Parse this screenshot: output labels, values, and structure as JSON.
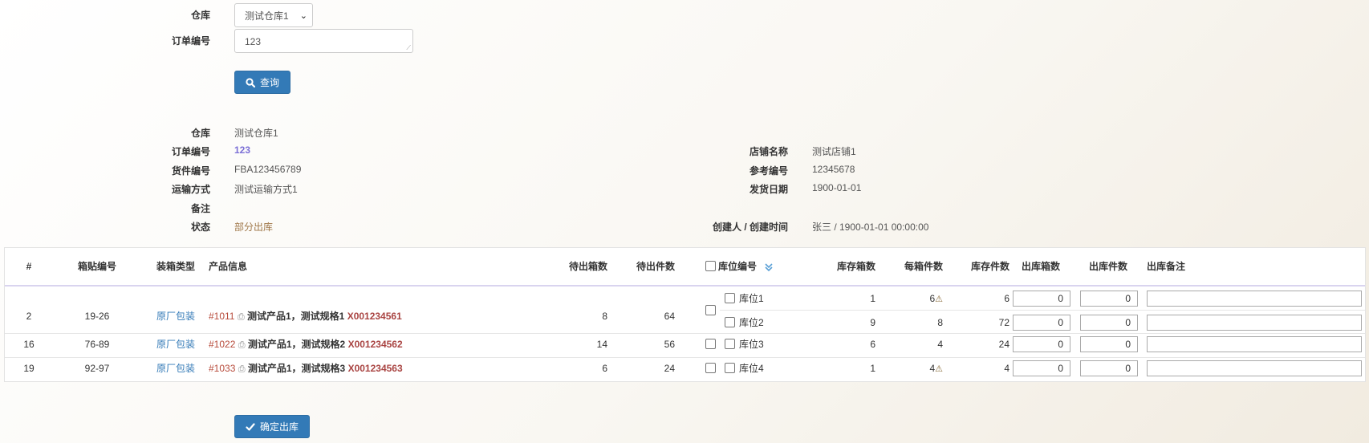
{
  "search_form": {
    "warehouse_label": "仓库",
    "warehouse_value": "测试仓库1",
    "order_label": "订单编号",
    "order_value": "123",
    "query_button": "查询"
  },
  "details": {
    "warehouse_label": "仓库",
    "warehouse_value": "测试仓库1",
    "order_label": "订单编号",
    "order_value": "123",
    "cargo_label": "货件编号",
    "cargo_value": "FBA123456789",
    "shipping_label": "运输方式",
    "shipping_value": "测试运输方式1",
    "note_label": "备注",
    "note_value": "",
    "status_label": "状态",
    "status_value": "部分出库",
    "shop_label": "店铺名称",
    "shop_value": "测试店铺1",
    "ref_label": "参考编号",
    "ref_value": "12345678",
    "ship_date_label": "发货日期",
    "ship_date_value": "1900-01-01",
    "creator_label": "创建人 / 创建时间",
    "creator_value": "张三 / 1900-01-01 00:00:00"
  },
  "table": {
    "headers": {
      "index": "#",
      "box_code": "箱贴编号",
      "pack_type": "装箱类型",
      "product": "产品信息",
      "pending_boxes": "待出箱数",
      "pending_pieces": "待出件数",
      "location": "库位编号",
      "stock_boxes": "库存箱数",
      "per_box": "每箱件数",
      "stock_pieces": "库存件数",
      "out_boxes": "出库箱数",
      "out_pieces": "出库件数",
      "out_note": "出库备注"
    },
    "rows": [
      {
        "index": "2",
        "box_code": "19-26",
        "pack_type": "原厂包装",
        "product_id": "#1011",
        "product_name": "测试产品1，测试规格1",
        "product_code": "X001234561",
        "pending_boxes": "8",
        "pending_pieces": "64",
        "locations": [
          {
            "name": "库位1",
            "stock_boxes": "1",
            "per_box": "6",
            "warn": true,
            "stock_pieces": "6",
            "out_boxes": "0",
            "out_pieces": "0"
          },
          {
            "name": "库位2",
            "stock_boxes": "9",
            "per_box": "8",
            "warn": false,
            "stock_pieces": "72",
            "out_boxes": "0",
            "out_pieces": "0"
          }
        ]
      },
      {
        "index": "16",
        "box_code": "76-89",
        "pack_type": "原厂包装",
        "product_id": "#1022",
        "product_name": "测试产品1，测试规格2",
        "product_code": "X001234562",
        "pending_boxes": "14",
        "pending_pieces": "56",
        "locations": [
          {
            "name": "库位3",
            "stock_boxes": "6",
            "per_box": "4",
            "warn": false,
            "stock_pieces": "24",
            "out_boxes": "0",
            "out_pieces": "0"
          }
        ]
      },
      {
        "index": "19",
        "box_code": "92-97",
        "pack_type": "原厂包装",
        "product_id": "#1033",
        "product_name": "测试产品1，测试规格3",
        "product_code": "X001234563",
        "pending_boxes": "6",
        "pending_pieces": "24",
        "locations": [
          {
            "name": "库位4",
            "stock_boxes": "1",
            "per_box": "4",
            "warn": true,
            "stock_pieces": "4",
            "out_boxes": "0",
            "out_pieces": "0"
          }
        ]
      }
    ]
  },
  "confirm_button": "确定出库",
  "colors": {
    "primary": "#337ab7",
    "status": "#a0784a",
    "link_red": "#b74a3a",
    "code_red": "#a94442"
  },
  "icons": {
    "query": "search-icon",
    "confirm": "check-icon",
    "print": "printer-icon",
    "warn": "warning-icon",
    "sort": "chevron-double-down-icon"
  }
}
